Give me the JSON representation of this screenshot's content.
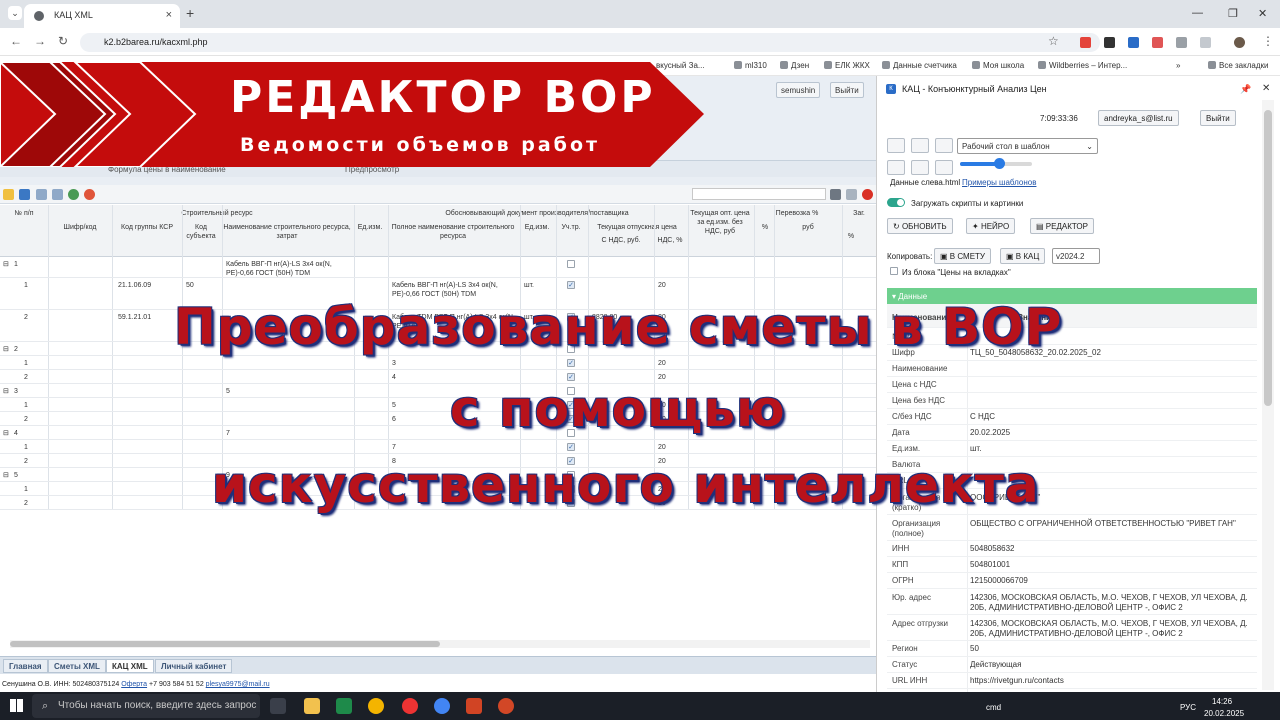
{
  "browser": {
    "tab_title": "КАЦ XML",
    "url": "k2.b2barea.ru/kacxml.php",
    "bookmarks": [
      "вкусный За...",
      "ml310",
      "Дзен",
      "ЕЛК ЖКХ",
      "Данные счетчика",
      "Моя школа",
      "Wildberries – Интер...",
      "Все закладки"
    ]
  },
  "banner": {
    "title": "РЕДАКТОР ВОР",
    "subtitle": "Ведомости объемов работ"
  },
  "overlay": {
    "line1": "Преобразование сметы в ВОР",
    "line2": "с помощью",
    "line3": "искусственного интеллекта"
  },
  "app": {
    "user": "semushin",
    "exit": "Выйти",
    "column_pane": {
      "formula": "Формула цены в наименование",
      "preview": "Предпросмотр"
    }
  },
  "table": {
    "group_headers": {
      "num": "№ п/п",
      "resource": "Строительный ресурс",
      "doc": "Обосновывающий документ производителя/поставщика",
      "wholesale": "Текущая опт. цена за ед.изм. без НДС, руб",
      "transport": "Перевозка %",
      "zag": "Заг."
    },
    "sub_headers": {
      "cipher": "Шифр/код",
      "ksr": "Код группы КСР",
      "subj": "Код субъекта",
      "name": "Наименование строительного ресурса, затрат",
      "unit": "Ед.изм.",
      "fullname": "Полное наименование строительного ресурса",
      "unit2": "Ед.изм.",
      "uchtr": "Уч.тр.",
      "price": "Текущая отпускная цена",
      "with_vat": "С НДС, руб.",
      "vat": "НДС, %",
      "pct": "%",
      "rub": "руб",
      "pct2": "%"
    },
    "rows": [
      {
        "num": "1",
        "ksr": "",
        "subj": "",
        "name": "Кабель ВВГ-П нг(A)-LS 3х4 ок(N, PE)-0,66 ГОСТ (50Н) TDM",
        "full": "",
        "unit": "",
        "check": false,
        "price": "",
        "vat": ""
      },
      {
        "num": "1",
        "ksr": "21.1.06.09",
        "subj": "50",
        "name": "",
        "full": "Кабель ВВГ-П нг(A)-LS 3х4 ок(N, PE)-0,66 ГОСТ (50Н) TDM",
        "unit": "шт.",
        "check": true,
        "price": "",
        "vat": "20"
      },
      {
        "num": "2",
        "ksr": "59.1.21.01",
        "subj": "",
        "name": "",
        "full": "Кабель TDM ВВГ-П нг(A)-LS 3х4 ок(N, PE)-0,66",
        "unit": "шт.",
        "check": true,
        "price": "8828.00",
        "vat": "20"
      },
      {
        "num": "2",
        "ksr": "",
        "subj": "",
        "name": "",
        "full": "",
        "unit": "",
        "check": false,
        "price": "",
        "vat": ""
      },
      {
        "num": "1",
        "ksr": "",
        "subj": "",
        "name": "",
        "full": "3",
        "unit": "",
        "check": true,
        "price": "",
        "vat": "20"
      },
      {
        "num": "2",
        "ksr": "",
        "subj": "",
        "name": "",
        "full": "4",
        "unit": "",
        "check": true,
        "price": "",
        "vat": "20"
      },
      {
        "num": "3",
        "ksr": "",
        "subj": "",
        "name": "5",
        "full": "",
        "unit": "",
        "check": false,
        "price": "",
        "vat": ""
      },
      {
        "num": "1",
        "ksr": "",
        "subj": "",
        "name": "",
        "full": "5",
        "unit": "",
        "check": true,
        "price": "",
        "vat": "20"
      },
      {
        "num": "2",
        "ksr": "",
        "subj": "",
        "name": "",
        "full": "6",
        "unit": "",
        "check": true,
        "price": "",
        "vat": "20"
      },
      {
        "num": "4",
        "ksr": "",
        "subj": "",
        "name": "7",
        "full": "",
        "unit": "",
        "check": false,
        "price": "",
        "vat": ""
      },
      {
        "num": "1",
        "ksr": "",
        "subj": "",
        "name": "",
        "full": "7",
        "unit": "",
        "check": true,
        "price": "",
        "vat": "20"
      },
      {
        "num": "2",
        "ksr": "",
        "subj": "",
        "name": "",
        "full": "8",
        "unit": "",
        "check": true,
        "price": "",
        "vat": "20"
      },
      {
        "num": "5",
        "ksr": "",
        "subj": "",
        "name": "9",
        "full": "",
        "unit": "",
        "check": false,
        "price": "",
        "vat": ""
      },
      {
        "num": "1",
        "ksr": "",
        "subj": "",
        "name": "",
        "full": "",
        "unit": "",
        "check": true,
        "price": "",
        "vat": "20"
      },
      {
        "num": "2",
        "ksr": "",
        "subj": "",
        "name": "",
        "full": "",
        "unit": "",
        "check": true,
        "price": "",
        "vat": "20"
      }
    ]
  },
  "bottom_tabs": [
    "Главная",
    "Сметы XML",
    "КАЦ XML",
    "Личный кабинет"
  ],
  "status": {
    "text": "Сенушина О.В. ИНН: 502480375124",
    "offer": "Оферта",
    "phone": "+7 903 584 51 52",
    "email": "plesya9975@mail.ru"
  },
  "panel": {
    "title": "КАЦ - Конъюнктурный Анализ Цен",
    "time": "7:09:33:36",
    "user": "andreyka_s@list.ru",
    "exit": "Выйти",
    "desk_select": "Рабочий стол в шаблон",
    "data_left": "Данные слева.html",
    "examples": "Примеры шаблонов",
    "load_scripts": "Загружать скрипты и картинки",
    "btn_update": "ОБНОВИТЬ",
    "btn_neuro": "НЕЙРО",
    "btn_editor": "РЕДАКТОР",
    "copy_label": "Копировать:",
    "btn_to_smeta": "В СМЕТУ",
    "btn_to_kac": "В КАЦ",
    "version": "v2024.2",
    "from_block": "Из блока \"Цены на вкладках\"",
    "data_header": "Данные",
    "col_name": "Наименование",
    "col_value": "Значение",
    "props": [
      {
        "k": "№ п/п",
        "v": ""
      },
      {
        "k": "Шифр",
        "v": "ТЦ_50_5048058632_20.02.2025_02"
      },
      {
        "k": "Наименование",
        "v": ""
      },
      {
        "k": "Цена с НДС",
        "v": ""
      },
      {
        "k": "Цена без НДС",
        "v": ""
      },
      {
        "k": "С/без НДС",
        "v": "С НДС"
      },
      {
        "k": "Дата",
        "v": "20.02.2025"
      },
      {
        "k": "Ед.изм.",
        "v": "шт."
      },
      {
        "k": "Валюта",
        "v": ""
      },
      {
        "k": "URL",
        "v": ""
      },
      {
        "k": "Организация (кратко)",
        "v": "ООО \"РИВЕТ ГАН\""
      },
      {
        "k": "Организация (полное)",
        "v": "ОБЩЕСТВО С ОГРАНИЧЕННОЙ ОТВЕТСТВЕННОСТЬЮ \"РИВЕТ ГАН\""
      },
      {
        "k": "ИНН",
        "v": "5048058632"
      },
      {
        "k": "КПП",
        "v": "504801001"
      },
      {
        "k": "ОГРН",
        "v": "1215000066709"
      },
      {
        "k": "Юр. адрес",
        "v": "142306, МОСКОВСКАЯ ОБЛАСТЬ, М.О. ЧЕХОВ, Г ЧЕХОВ, УЛ ЧЕХОВА, Д. 20Б, АДМИНИСТРАТИВНО-ДЕЛОВОЙ ЦЕНТР -, ОФИС 2"
      },
      {
        "k": "Адрес отгрузки",
        "v": "142306, МОСКОВСКАЯ ОБЛАСТЬ, М.О. ЧЕХОВ, Г ЧЕХОВ, УЛ ЧЕХОВА, Д. 20Б, АДМИНИСТРАТИВНО-ДЕЛОВОЙ ЦЕНТР -, ОФИС 2"
      },
      {
        "k": "Регион",
        "v": "50"
      },
      {
        "k": "Статус",
        "v": "Действующая"
      },
      {
        "k": "URL ИНН",
        "v": "https://rivetgun.ru/contacts"
      }
    ]
  },
  "taskbar": {
    "search": "Чтобы начать поиск, введите здесь запрос",
    "cmd": "cmd",
    "lang": "РУС",
    "time": "14:26",
    "date": "20.02.2025"
  }
}
